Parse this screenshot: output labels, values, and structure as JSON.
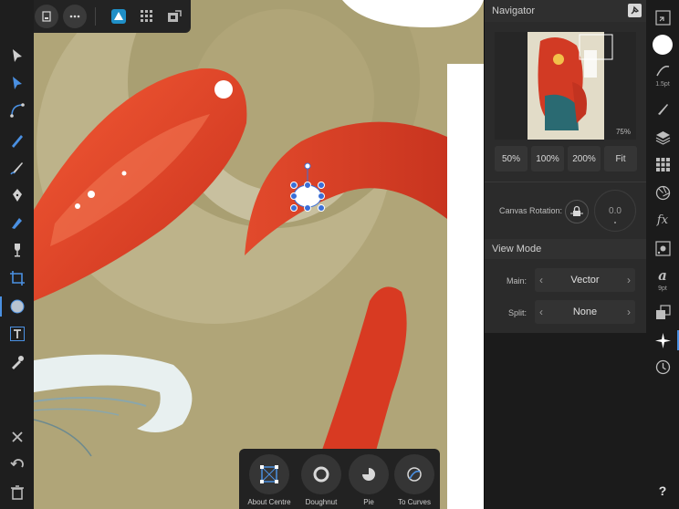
{
  "navigator": {
    "title": "Navigator",
    "zoom_readout": "75%",
    "zoom_buttons": [
      "50%",
      "100%",
      "200%",
      "Fit"
    ],
    "canvas_rotation_label": "Canvas Rotation:",
    "rotation_value": "0.0",
    "view_mode_title": "View Mode",
    "main_label": "Main:",
    "main_value": "Vector",
    "split_label": "Split:",
    "split_value": "None"
  },
  "right_strip": {
    "stroke_width": "1.5pt",
    "font_size": "9pt",
    "fx_label": "fx",
    "help": "?"
  },
  "context_bar": {
    "buttons": [
      "About Centre",
      "Doughnut",
      "Pie",
      "To Curves"
    ]
  },
  "colors": {
    "canvas_bg": "#b0a578",
    "accent": "#4a90e2",
    "shape_red": "#e8432a"
  }
}
